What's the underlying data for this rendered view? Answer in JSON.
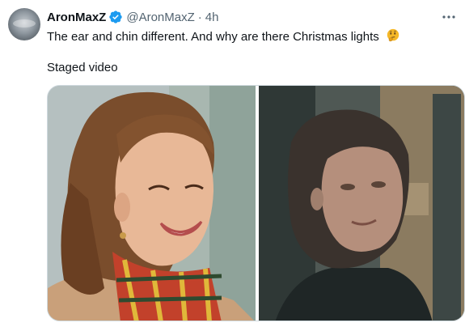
{
  "tweet": {
    "display_name": "AronMaxZ",
    "handle": "@AronMaxZ",
    "separator": "·",
    "time": "4h",
    "text": "The ear and chin different. And why are there Christmas lights",
    "emoji_icon": "thinking-face-icon",
    "subtext": "Staged video"
  },
  "media": {
    "images": [
      {
        "name": "photo-left",
        "description": "Smiling woman with brown hair and plaid scarf"
      },
      {
        "name": "photo-right",
        "description": "Blurry still of woman with dark hair"
      }
    ]
  },
  "colors": {
    "verified": "#1d9bf0",
    "secondary_text": "#536471",
    "primary_text": "#0f1419",
    "border": "#cfd9de"
  }
}
